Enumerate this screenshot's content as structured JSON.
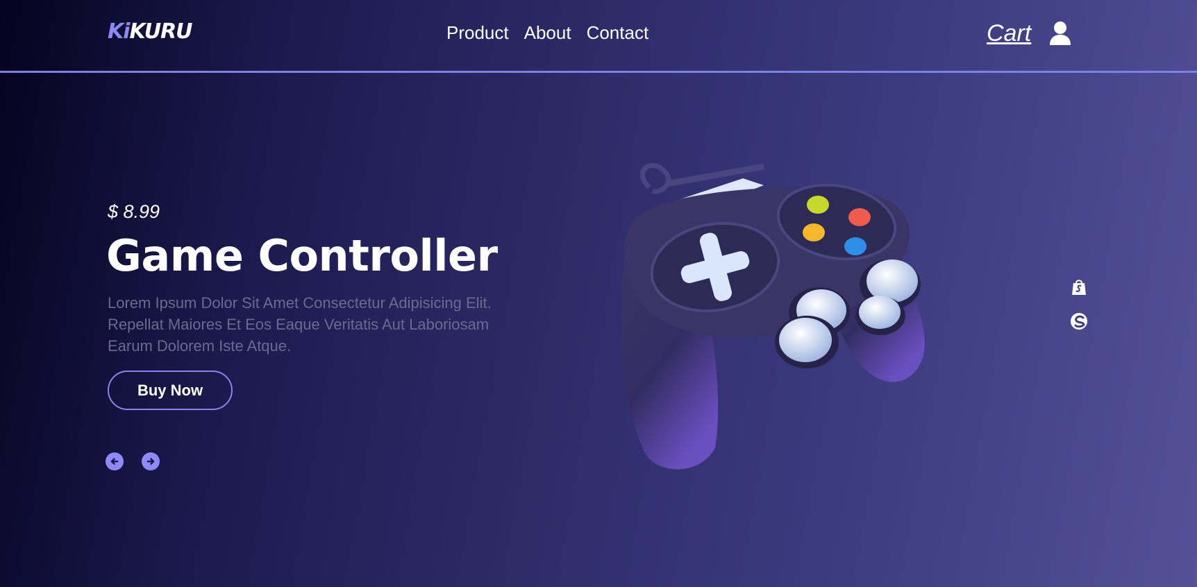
{
  "header": {
    "logo": {
      "part1": "Ki",
      "part2": "KURU"
    },
    "nav": [
      {
        "label": "Product"
      },
      {
        "label": "About"
      },
      {
        "label": "Contact"
      }
    ],
    "cart_label": "Cart",
    "user_icon": "user-icon"
  },
  "hero": {
    "price": "$ 8.99",
    "title": "Game Controller",
    "description": "Lorem Ipsum Dolor Sit Amet Consectetur Adipisicing Elit. Repellat Maiores Et Eos Eaque Veritatis Aut Laboriosam Earum Dolorem Iste Atque.",
    "buy_label": "Buy Now",
    "prev_icon": "arrow-left-circle-icon",
    "next_icon": "arrow-right-circle-icon"
  },
  "side_icons": [
    "shopify-icon",
    "swirl-icon"
  ],
  "colors": {
    "accent": "#8f89f5",
    "divider": "#7f7fe6",
    "description_text": "#6a6a90",
    "bg_left": "#05031f",
    "bg_right": "#545197"
  }
}
